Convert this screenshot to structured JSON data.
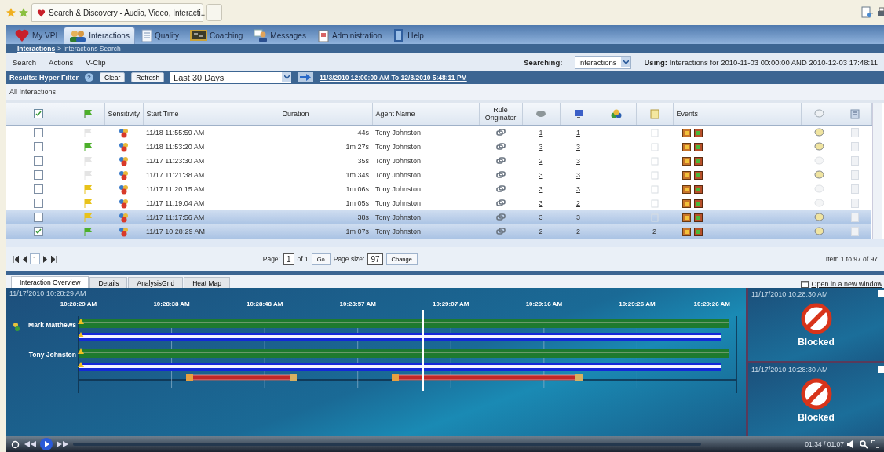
{
  "browser": {
    "tab_title": "Search & Discovery - Audio, Video, Interacti..."
  },
  "nav_tabs": [
    {
      "label": "My VPI",
      "selected": false
    },
    {
      "label": "Interactions",
      "selected": true
    },
    {
      "label": "Quality",
      "selected": false
    },
    {
      "label": "Coaching",
      "selected": false
    },
    {
      "label": "Messages",
      "selected": false
    },
    {
      "label": "Administration",
      "selected": false
    },
    {
      "label": "Help",
      "selected": false
    }
  ],
  "breadcrumb": {
    "link": "Interactions",
    "current": "> Interactions Search"
  },
  "menu": [
    "Search",
    "Actions",
    "V-Clip"
  ],
  "searching": {
    "label": "Searching:",
    "value": "Interactions"
  },
  "using": {
    "label": "Using:",
    "text": "Interactions for 2010-11-03 00:00:00 AND 2010-12-03 17:48:11"
  },
  "filter_bar": {
    "title": "Results: Hyper Filter",
    "help": "?",
    "buttons": [
      "Clear",
      "Refresh"
    ],
    "range": "Last 30 Days",
    "range_link": "11/3/2010 12:00:00 AM  To  12/3/2010 5:48:11 PM"
  },
  "view_title": "All Interactions",
  "table": {
    "columns": [
      {
        "kind": "checkbox"
      },
      {
        "kind": "flag"
      },
      {
        "kind": "text",
        "label": "Sensitivity"
      },
      {
        "kind": "text",
        "label": "Start Time"
      },
      {
        "kind": "text",
        "label": "Duration"
      },
      {
        "kind": "text",
        "label": "Agent Name"
      },
      {
        "kind": "text",
        "label": "Rule Originator"
      },
      {
        "kind": "icon"
      },
      {
        "kind": "icon"
      },
      {
        "kind": "icon"
      },
      {
        "kind": "icon"
      },
      {
        "kind": "text",
        "label": "Events"
      },
      {
        "kind": "icon"
      },
      {
        "kind": "icon"
      }
    ],
    "rows": [
      {
        "selected": false,
        "checked": false,
        "flag": {
          "color": "#e4e4e4"
        },
        "start": "11/18 11:55:59 AM",
        "duration": "44s",
        "agent": "Tony Johnston",
        "count_a": "1",
        "count_b": "1",
        "commented": true
      },
      {
        "selected": false,
        "checked": false,
        "flag": {
          "color": "#4caf2a"
        },
        "start": "11/18 11:53:20 AM",
        "duration": "1m 27s",
        "agent": "Tony Johnston",
        "count_a": "3",
        "count_b": "3",
        "commented": true
      },
      {
        "selected": false,
        "checked": false,
        "flag": {
          "color": "#e4e4e4"
        },
        "start": "11/17 11:23:30 AM",
        "duration": "35s",
        "agent": "Tony Johnston",
        "count_a": "2",
        "count_b": "3",
        "commented": false
      },
      {
        "selected": false,
        "checked": false,
        "flag": {
          "color": "#e4e4e4"
        },
        "start": "11/17 11:21:38 AM",
        "duration": "1m 34s",
        "agent": "Tony Johnston",
        "count_a": "3",
        "count_b": "3",
        "commented": true
      },
      {
        "selected": false,
        "checked": false,
        "flag": {
          "color": "#e8c21a"
        },
        "start": "11/17 11:20:15 AM",
        "duration": "1m 06s",
        "agent": "Tony Johnston",
        "count_a": "3",
        "count_b": "3",
        "commented": false
      },
      {
        "selected": false,
        "checked": false,
        "flag": {
          "color": "#e8c21a"
        },
        "start": "11/17 11:19:04 AM",
        "duration": "1m 05s",
        "agent": "Tony Johnston",
        "count_a": "3",
        "count_b": "2",
        "commented": false
      },
      {
        "selected": true,
        "checked": false,
        "flag": {
          "color": "#e8c21a"
        },
        "start": "11/17 11:17:56 AM",
        "duration": "38s",
        "agent": "Tony Johnston",
        "count_a": "3",
        "count_b": "3",
        "commented": true
      },
      {
        "selected": true,
        "checked": true,
        "flag": {
          "color": "#4caf2a"
        },
        "start": "11/17 10:28:29 AM",
        "duration": "1m 07s",
        "agent": "Tony Johnston",
        "count_a": "2",
        "count_b": "2",
        "notes": "2",
        "commented": true
      }
    ]
  },
  "pager": {
    "current_page": "1",
    "page_label": "Page:",
    "page": "1",
    "of": "of 1",
    "go": "Go",
    "size_label": "Page size:",
    "size": "97",
    "change": "Change",
    "summary": "Item 1 to 97 of 97"
  },
  "detail_tabs": [
    {
      "label": "Interaction Overview",
      "selected": true
    },
    {
      "label": "Details",
      "selected": false
    },
    {
      "label": "AnalysisGrid",
      "selected": false
    },
    {
      "label": "Heat Map",
      "selected": false
    }
  ],
  "open_link": "Open in a new window",
  "timeline": {
    "date": "11/17/2010 10:28:29 AM",
    "ticks": [
      "10:28:29 AM",
      "10:28:38 AM",
      "10:28:48 AM",
      "10:28:57 AM",
      "10:29:07 AM",
      "10:29:16 AM",
      "10:29:26 AM",
      "10:29:26 AM"
    ],
    "participants": [
      "Mark Matthews",
      "Tony Johnston"
    ]
  },
  "video_panels": [
    {
      "time": "11/17/2010 10:28:30 AM",
      "status": "Blocked"
    },
    {
      "time": "11/17/2010 10:28:30 AM",
      "status": "Blocked"
    }
  ],
  "player": {
    "time": "01:34 / 01:07"
  }
}
